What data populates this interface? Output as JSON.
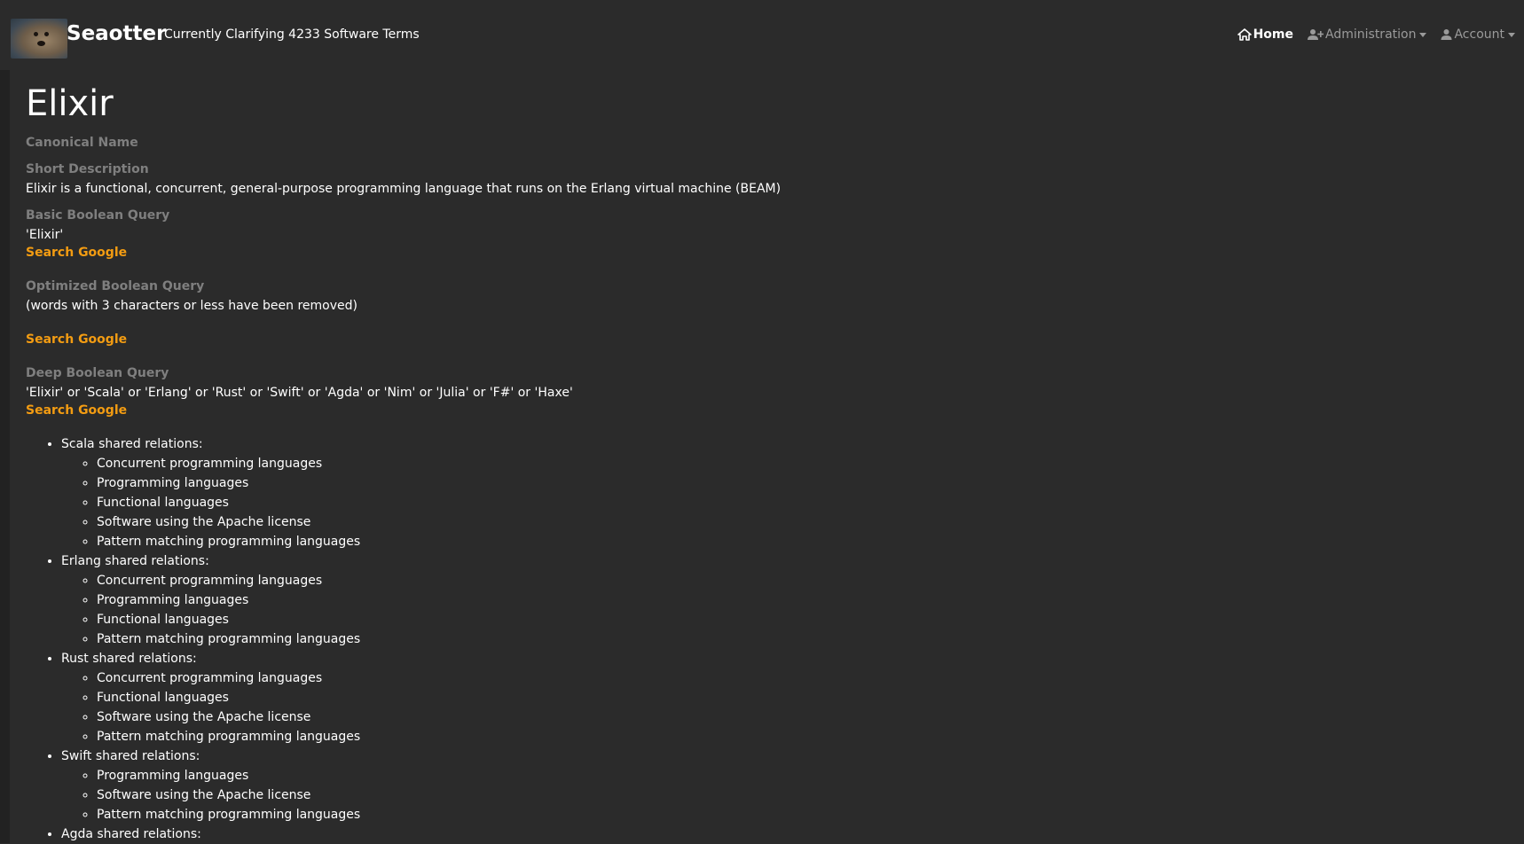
{
  "navbar": {
    "brand": "Seaotter",
    "tagline": "Currently Clarifying 4233 Software Terms",
    "links": [
      {
        "label": "Home",
        "icon": "home-icon",
        "active": true
      },
      {
        "label": "Administration",
        "icon": "user-plus-icon",
        "active": false,
        "dropdown": true
      },
      {
        "label": "Account",
        "icon": "user-icon",
        "active": false,
        "dropdown": true
      }
    ]
  },
  "term": {
    "title": "Elixir",
    "canonical_label": "Canonical Name",
    "short_desc_label": "Short Description",
    "short_desc": "Elixir is a functional, concurrent, general-purpose programming language that runs on the Erlang virtual machine (BEAM)",
    "basic_label": "Basic Boolean Query",
    "basic_query": "'Elixir'",
    "optimized_label": "Optimized Boolean Query",
    "optimized_note": "(words with 3 characters or less have been removed)",
    "deep_label": "Deep Boolean Query",
    "deep_query": "'Elixir' or 'Scala' or 'Erlang' or 'Rust' or 'Swift' or 'Agda' or 'Nim' or 'Julia' or 'F#' or 'Haxe'",
    "search_label": "Search Google"
  },
  "relations": [
    {
      "title": "Scala shared relations:",
      "items": [
        "Concurrent programming languages",
        "Programming languages",
        "Functional languages",
        "Software using the Apache license",
        "Pattern matching programming languages"
      ]
    },
    {
      "title": "Erlang shared relations:",
      "items": [
        "Concurrent programming languages",
        "Programming languages",
        "Functional languages",
        "Pattern matching programming languages"
      ]
    },
    {
      "title": "Rust shared relations:",
      "items": [
        "Concurrent programming languages",
        "Functional languages",
        "Software using the Apache license",
        "Pattern matching programming languages"
      ]
    },
    {
      "title": "Swift shared relations:",
      "items": [
        "Programming languages",
        "Software using the Apache license",
        "Pattern matching programming languages"
      ]
    },
    {
      "title": "Agda shared relations:",
      "items": []
    }
  ],
  "colors": {
    "background": "#2b2b2b",
    "link": "#f39c12",
    "label": "#7f7f7f"
  }
}
